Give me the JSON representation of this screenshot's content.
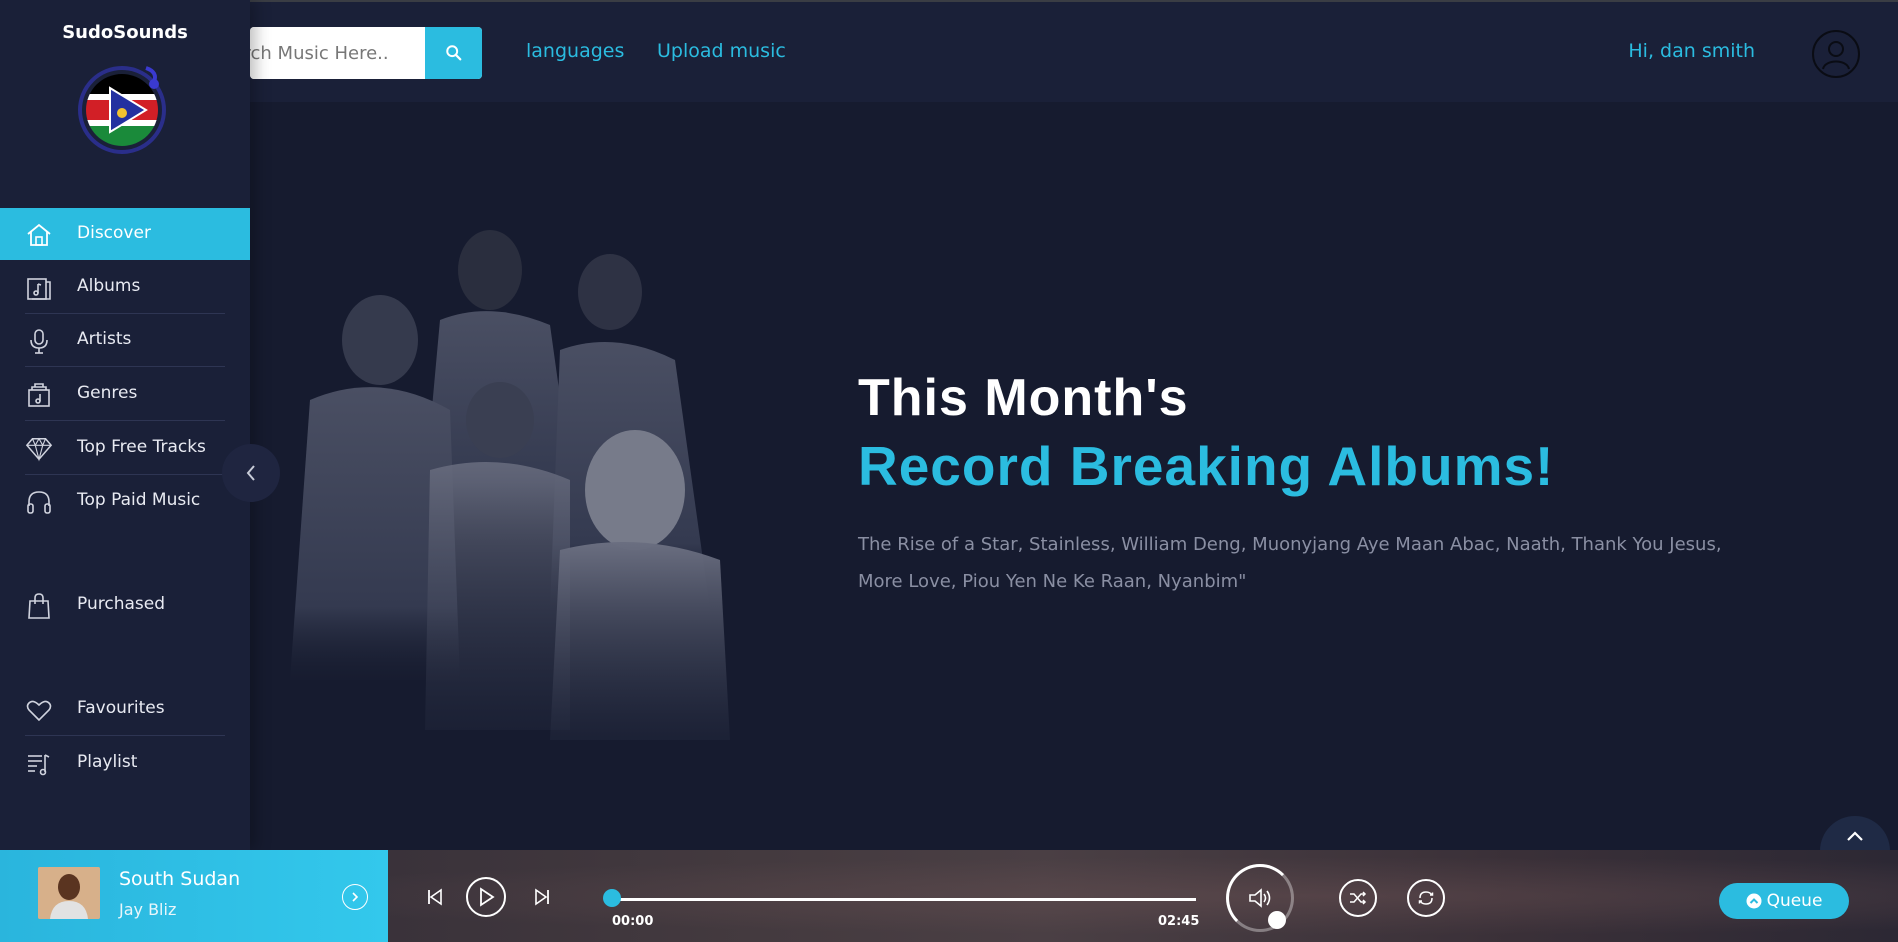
{
  "app": {
    "brand": "SudoSounds"
  },
  "header": {
    "search_placeholder": "Search Music Here..",
    "nav_languages": "languages",
    "nav_upload": "Upload music",
    "greeting": "Hi, dan smith"
  },
  "sidebar": {
    "items": [
      {
        "label": "Discover",
        "icon": "home-icon",
        "active": true
      },
      {
        "label": "Albums",
        "icon": "album-icon"
      },
      {
        "label": "Artists",
        "icon": "microphone-icon"
      },
      {
        "label": "Genres",
        "icon": "genre-icon"
      },
      {
        "label": "Top Free Tracks",
        "icon": "diamond-icon"
      },
      {
        "label": "Top Paid Music",
        "icon": "headphones-icon"
      },
      {
        "label": "Purchased",
        "icon": "shopping-bag-icon"
      },
      {
        "label": "Favourites",
        "icon": "heart-icon"
      },
      {
        "label": "Playlist",
        "icon": "playlist-icon"
      }
    ]
  },
  "hero": {
    "title_line1": "This Month's",
    "title_line2": "Record Breaking Albums!",
    "description": "The Rise of a Star, Stainless, William Deng, Muonyjang Aye Maan Abac, Naath, Thank You Jesus, More Love, Piou Yen Ne Ke Raan, Nyanbim\""
  },
  "player": {
    "track_title": "South Sudan",
    "artist": "Jay Bliz",
    "current_time": "00:00",
    "duration": "02:45",
    "progress": 0,
    "queue_label": "Queue"
  },
  "colors": {
    "accent": "#2bbce0",
    "background": "#161b2f",
    "panel": "#1a2038"
  }
}
